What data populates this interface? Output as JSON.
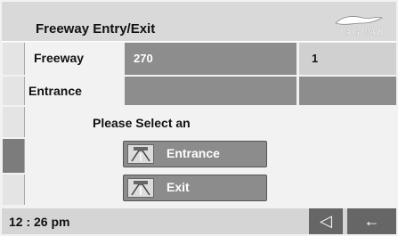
{
  "header": {
    "title": "Freeway Entry/Exit",
    "logo_text": "JAGUAR"
  },
  "freeway_row": {
    "label": "Freeway",
    "value": "270",
    "aux_value": "1"
  },
  "entrance_row": {
    "label": "Entrance"
  },
  "prompt": "Please Select an",
  "options": [
    {
      "label": "Entrance",
      "icon": "freeway-entrance-icon"
    },
    {
      "label": "Exit",
      "icon": "freeway-exit-icon"
    }
  ],
  "status_bar": {
    "clock": "12 : 26 pm",
    "mute_symbol": "◁",
    "back_symbol": "←"
  }
}
